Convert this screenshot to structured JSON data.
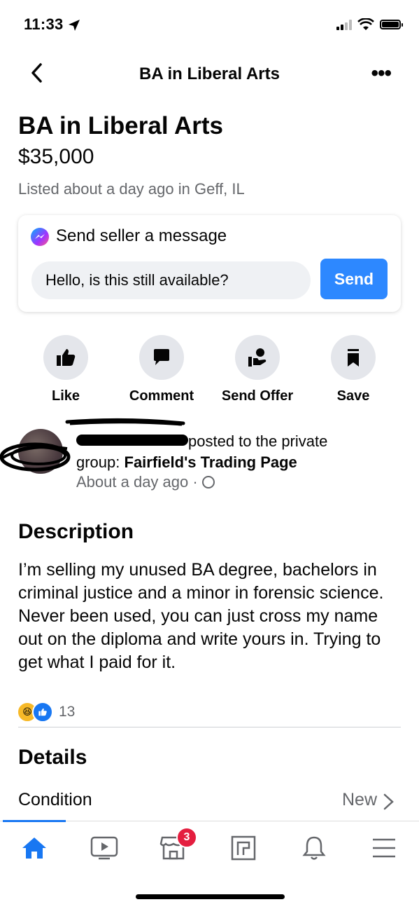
{
  "status_bar": {
    "time": "11:33"
  },
  "nav": {
    "title": "BA in Liberal Arts"
  },
  "listing": {
    "title": "BA in Liberal Arts",
    "price": "$35,000",
    "listed": "Listed about a day ago in Geff, IL"
  },
  "message_card": {
    "title": "Send seller a message",
    "input_value": "Hello, is this still available?",
    "send_label": "Send"
  },
  "actions": [
    {
      "label": "Like",
      "icon": "thumbs-up-icon"
    },
    {
      "label": "Comment",
      "icon": "comment-icon"
    },
    {
      "label": "Send Offer",
      "icon": "offer-icon"
    },
    {
      "label": "Save",
      "icon": "bookmark-icon"
    }
  ],
  "post": {
    "posted_text": "posted to the private",
    "group_prefix": "group: ",
    "group_name": "Fairfield's Trading Page",
    "time": "About a day ago ·"
  },
  "description": {
    "heading": "Description",
    "text": "I’m selling my unused BA degree, bachelors in criminal justice and a minor in forensic science. Never been used, you can just cross my name out on the diploma and write yours in. Trying to get what I paid for it."
  },
  "reactions": {
    "count": "13"
  },
  "details": {
    "heading": "Details",
    "condition_label": "Condition",
    "condition_value": "New"
  },
  "tabbar": {
    "marketplace_badge": "3"
  },
  "colors": {
    "accent": "#1877f2",
    "send_button": "#2d88ff",
    "badge": "#e41e3f"
  }
}
